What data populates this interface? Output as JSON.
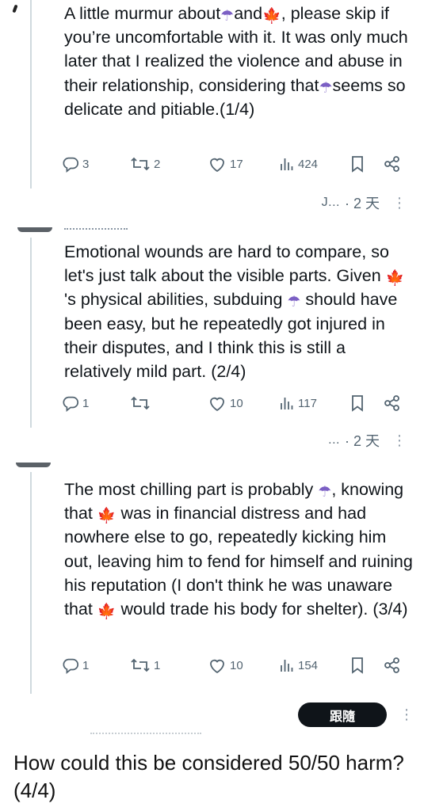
{
  "posts": [
    {
      "segments": [
        {
          "t": "A little murmur about"
        },
        {
          "e": "☂",
          "kind": "umbrella"
        },
        {
          "t": "and"
        },
        {
          "e": "🍁",
          "kind": "leaf"
        },
        {
          "t": ", please skip if you’re uncomfortable with it. It was only much later that I realized the violence and abuse in their relationship, considering that"
        },
        {
          "e": "☂",
          "kind": "umbrella"
        },
        {
          "t": "seems so delicate and pitiable.(1/4)"
        }
      ],
      "replies": "3",
      "reposts": "2",
      "likes": "17",
      "views": "424",
      "meta_name": "J...",
      "meta_time": "· 2 天"
    },
    {
      "segments": [
        {
          "t": "Emotional wounds are hard to compare, so let's just talk about the visible parts. Given "
        },
        {
          "e": "🍁",
          "kind": "leaf"
        },
        {
          "t": "'s physical abilities, subduing "
        },
        {
          "e": "☂",
          "kind": "umbrella"
        },
        {
          "t": " should have been easy, but he repeatedly got injured in their disputes, and I think this is still a relatively mild part. (2/4)"
        }
      ],
      "replies": "1",
      "reposts": "",
      "likes": "10",
      "views": "117",
      "meta_name": "...",
      "meta_time": "· 2 天"
    },
    {
      "segments": [
        {
          "t": "The most chilling part is probably "
        },
        {
          "e": "☂",
          "kind": "umbrella"
        },
        {
          "t": ", knowing that "
        },
        {
          "e": "🍁",
          "kind": "leaf"
        },
        {
          "t": " was in financial distress and had nowhere else to go, repeatedly kicking him out, leaving him to fend for himself and ruining his reputation (I don't think he was unaware that "
        },
        {
          "e": "🍁",
          "kind": "leaf"
        },
        {
          "t": " would trade his body for shelter). (3/4)"
        }
      ],
      "replies": "1",
      "reposts": "1",
      "likes": "10",
      "views": "154"
    }
  ],
  "follow_button": "跟隨",
  "more_dots": "⋮",
  "footer_text": "How could this be considered 50/50 harm? (4/4)",
  "icons": [
    "reply-icon",
    "repost-icon",
    "like-icon",
    "views-icon",
    "bookmark-icon",
    "share-icon"
  ],
  "colors": {
    "text": "#0f1419",
    "muted": "#536471",
    "button_bg": "#0f1419",
    "button_text": "#ffffff",
    "umbrella": "#7b5fc4",
    "leaf": "#d8321e"
  }
}
